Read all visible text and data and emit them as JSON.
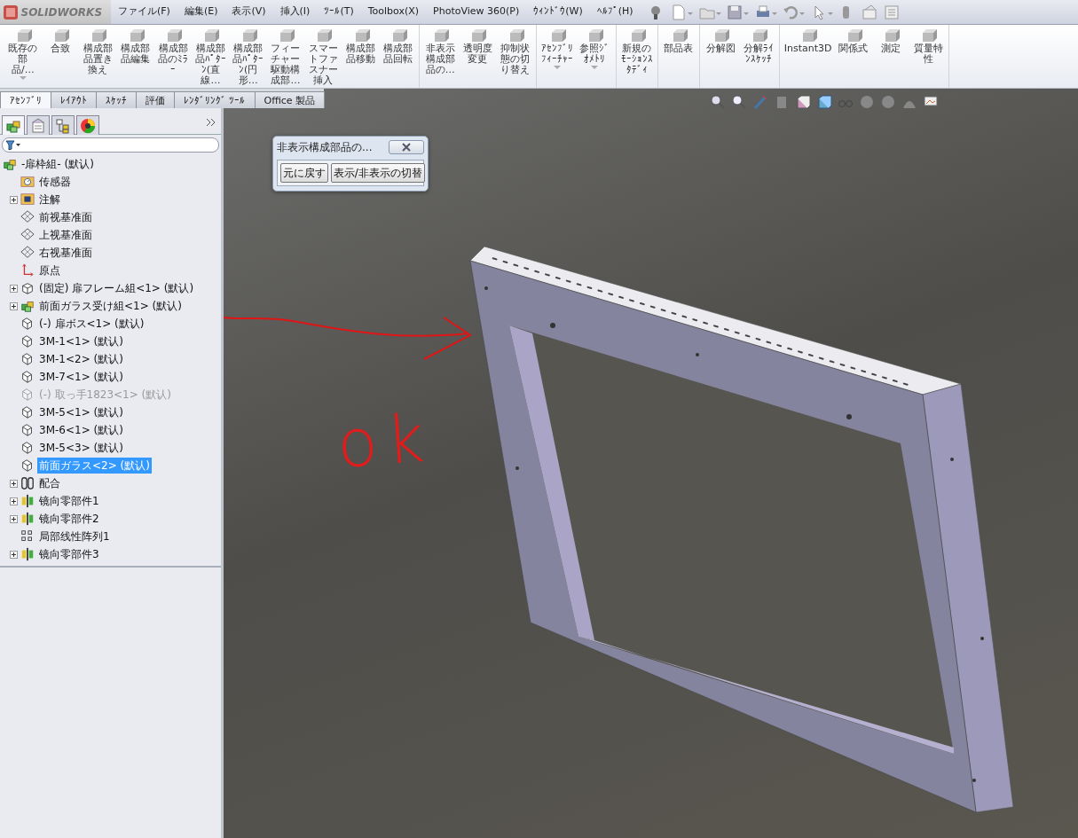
{
  "app": {
    "logo_text": "SOLIDWORKS"
  },
  "menu": [
    "ファイル(F)",
    "編集(E)",
    "表示(V)",
    "挿入(I)",
    "ﾂｰﾙ(T)",
    "Toolbox(X)",
    "PhotoView 360(P)",
    "ｳｨﾝﾄﾞｳ(W)",
    "ﾍﾙﾌﾟ(H)"
  ],
  "ribbon": {
    "groups": [
      [
        {
          "label": "既存の部品/…",
          "dropdown": true
        },
        {
          "label": "合致",
          "dropdown": false
        },
        {
          "label": "構成部品置き換え",
          "dropdown": false
        },
        {
          "label": "構成部品編集",
          "dropdown": false
        },
        {
          "label": "構成部品のﾐﾗｰ",
          "dropdown": false
        },
        {
          "label": "構成部品ﾊﾟﾀｰﾝ(直線…",
          "dropdown": false
        },
        {
          "label": "構成部品ﾊﾟﾀｰﾝ(円形…",
          "dropdown": false
        },
        {
          "label": "フィーチャー駆動構成部…",
          "dropdown": false
        },
        {
          "label": "スマートファスナー挿入",
          "dropdown": false
        },
        {
          "label": "構成部品移動",
          "dropdown": false
        },
        {
          "label": "構成部品回転",
          "dropdown": false
        }
      ],
      [
        {
          "label": "非表示構成部品の…",
          "dropdown": false
        },
        {
          "label": "透明度変更",
          "dropdown": false
        },
        {
          "label": "抑制状態の切り替え",
          "dropdown": false
        }
      ],
      [
        {
          "label": "ｱｾﾝﾌﾞﾘﾌｨｰﾁｬｰ",
          "dropdown": true
        },
        {
          "label": "参照ｼﾞｵﾒﾄﾘ",
          "dropdown": true
        }
      ],
      [
        {
          "label": "新規のﾓｰｼｮﾝｽﾀﾃﾞｨ",
          "dropdown": false
        }
      ],
      [
        {
          "label": "部品表",
          "dropdown": false
        }
      ],
      [
        {
          "label": "分解図",
          "dropdown": false
        },
        {
          "label": "分解ﾗｲﾝｽｹｯﾁ",
          "dropdown": false
        }
      ],
      [
        {
          "label": "Instant3D",
          "dropdown": false
        },
        {
          "label": "関係式",
          "dropdown": false
        },
        {
          "label": "測定",
          "dropdown": false
        },
        {
          "label": "質量特性",
          "dropdown": false
        }
      ]
    ]
  },
  "tabs": [
    {
      "label": "ｱｾﾝﾌﾞﾘ",
      "selected": true
    },
    {
      "label": "ﾚｲｱｳﾄ",
      "selected": false
    },
    {
      "label": "ｽｹｯﾁ",
      "selected": false
    },
    {
      "label": "評価",
      "selected": false
    },
    {
      "label": "ﾚﾝﾀﾞﾘﾝｸﾞ ﾂｰﾙ",
      "selected": false
    },
    {
      "label": "Office 製品",
      "selected": false
    }
  ],
  "feature_manager": {
    "tabs": [
      {
        "kind": "tree",
        "selected": true
      },
      {
        "kind": "properties",
        "selected": false
      },
      {
        "kind": "config",
        "selected": false
      },
      {
        "kind": "appearance",
        "selected": false
      }
    ],
    "tree": {
      "label": "-扉枠組- (默认)",
      "kind": "assembly",
      "children": [
        {
          "label": "传感器",
          "kind": "sensor",
          "expandable": false,
          "suppressed": false,
          "selected": false
        },
        {
          "label": "注解",
          "kind": "annotation",
          "expandable": true,
          "suppressed": false,
          "selected": false
        },
        {
          "label": "前视基准面",
          "kind": "plane",
          "expandable": false,
          "suppressed": false,
          "selected": false
        },
        {
          "label": "上视基准面",
          "kind": "plane",
          "expandable": false,
          "suppressed": false,
          "selected": false
        },
        {
          "label": "右视基准面",
          "kind": "plane",
          "expandable": false,
          "suppressed": false,
          "selected": false
        },
        {
          "label": "原点",
          "kind": "origin",
          "expandable": false,
          "suppressed": false,
          "selected": false
        },
        {
          "label": "(固定) 扉フレーム組<1> (默认)",
          "kind": "assembly-outline",
          "expandable": true,
          "suppressed": false,
          "selected": false
        },
        {
          "label": "前面ガラス受け組<1> (默认)",
          "kind": "assembly",
          "expandable": true,
          "suppressed": false,
          "selected": false
        },
        {
          "label": "(-) 扉ボス<1> (默认)",
          "kind": "part",
          "expandable": false,
          "suppressed": false,
          "selected": false
        },
        {
          "label": "3M-1<1> (默认)",
          "kind": "part",
          "expandable": false,
          "suppressed": false,
          "selected": false
        },
        {
          "label": "3M-1<2> (默认)",
          "kind": "part",
          "expandable": false,
          "suppressed": false,
          "selected": false
        },
        {
          "label": "3M-7<1> (默认)",
          "kind": "part",
          "expandable": false,
          "suppressed": false,
          "selected": false
        },
        {
          "label": "(-) 取っ手1823<1> (默认)",
          "kind": "part",
          "expandable": false,
          "suppressed": true,
          "selected": false
        },
        {
          "label": "3M-5<1> (默认)",
          "kind": "part",
          "expandable": false,
          "suppressed": false,
          "selected": false
        },
        {
          "label": "3M-6<1> (默认)",
          "kind": "part",
          "expandable": false,
          "suppressed": false,
          "selected": false
        },
        {
          "label": "3M-5<3> (默认)",
          "kind": "part",
          "expandable": false,
          "suppressed": false,
          "selected": false
        },
        {
          "label": "前面ガラス<2> (默认)",
          "kind": "part",
          "expandable": false,
          "suppressed": false,
          "selected": true
        },
        {
          "label": "配合",
          "kind": "mates",
          "expandable": true,
          "suppressed": false,
          "selected": false
        },
        {
          "label": "镜向零部件1",
          "kind": "mirror",
          "expandable": true,
          "suppressed": false,
          "selected": false
        },
        {
          "label": "镜向零部件2",
          "kind": "mirror",
          "expandable": true,
          "suppressed": false,
          "selected": false
        },
        {
          "label": "局部线性阵列1",
          "kind": "pattern",
          "expandable": false,
          "suppressed": false,
          "selected": false
        },
        {
          "label": "镜向零部件3",
          "kind": "mirror",
          "expandable": true,
          "suppressed": false,
          "selected": false
        }
      ]
    }
  },
  "dialog": {
    "title": "非表示構成部品の...",
    "buttons": [
      "元に戻す",
      "表示/非表示の切替"
    ]
  },
  "annotation": {
    "text": "ok"
  }
}
